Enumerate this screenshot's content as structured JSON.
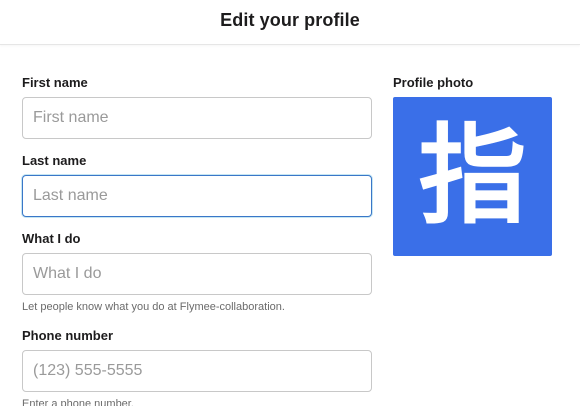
{
  "header": {
    "title": "Edit your profile"
  },
  "form": {
    "first_name": {
      "label": "First name",
      "placeholder": "First name",
      "value": ""
    },
    "last_name": {
      "label": "Last name",
      "placeholder": "Last name",
      "value": ""
    },
    "what_i_do": {
      "label": "What I do",
      "placeholder": "What I do",
      "value": "",
      "hint": "Let people know what you do at Flymee-collaboration."
    },
    "phone": {
      "label": "Phone number",
      "placeholder": "(123) 555-5555",
      "value": "",
      "hint": "Enter a phone number."
    }
  },
  "profile_photo": {
    "label": "Profile photo",
    "character": "指",
    "background_color": "#3a6fe8"
  },
  "colors": {
    "focus_border": "#3a77c8",
    "input_border": "#c8c8c8",
    "text_primary": "#1d1c1d",
    "text_hint": "#6b6b6b"
  }
}
